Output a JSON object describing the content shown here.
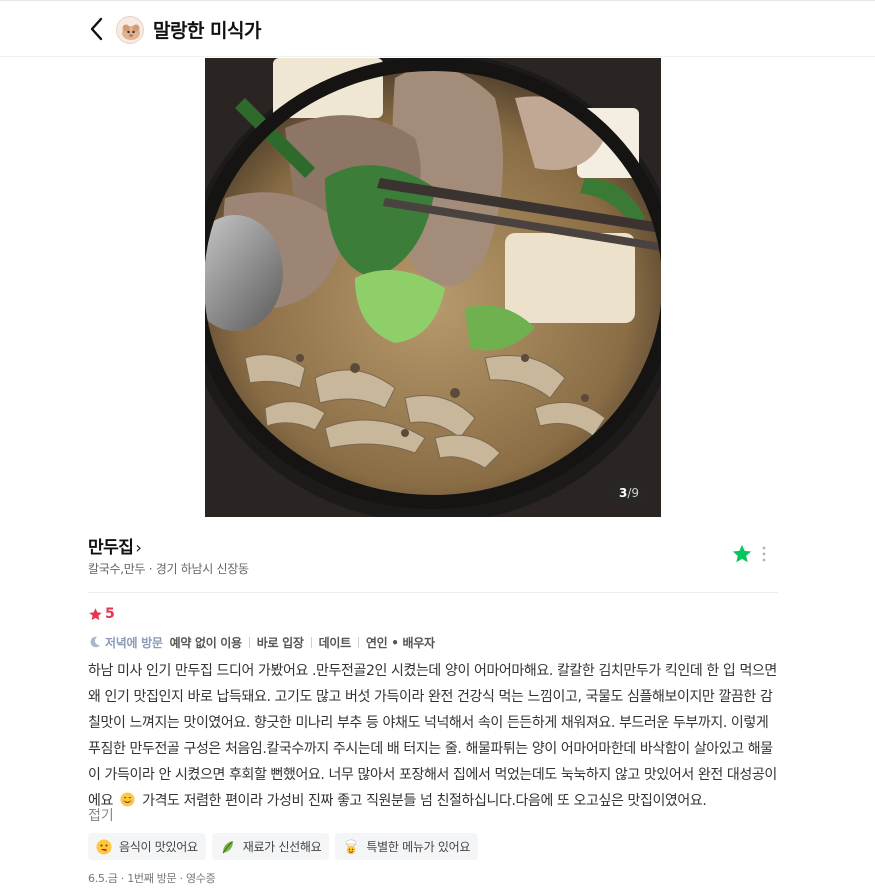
{
  "header": {
    "title": "말랑한 미식가"
  },
  "photo": {
    "current": "3",
    "separator": "/",
    "total": "9"
  },
  "place": {
    "name": "만두집",
    "category": "칼국수,만두",
    "dot": " · ",
    "location": "경기 하남시 신장동"
  },
  "rating": {
    "score": "5",
    "color": "#e8344e"
  },
  "visit_tags": {
    "time": "저녁에 방문",
    "items": [
      "예약 없이 이용",
      "바로 입장",
      "데이트",
      "연인 • 배우자"
    ]
  },
  "review": {
    "text_before_emoji": "하남 미사 인기 만두집 드디어 가봤어요 .만두전골2인 시켰는데 양이 어마어마해요. 칼칼한 김치만두가 킥인데 한 입 먹으면 왜 인기 맛집인지 바로 납득돼요. 고기도 많고 버섯 가득이라 완전 건강식 먹는 느낌이고, 국물도 심플해보이지만 깔끔한 감칠맛이 느껴지는 맛이였어요. 향긋한 미나리 부추 등 야채도 넉넉해서 속이 든든하게 채워져요. 부드러운 두부까지. 이렇게 푸짐한 만두전골 구성은 처음임.칼국수까지 주시는데 배 터지는 줄. 해물파튀는 양이 어마어마한데 바삭함이 살아있고 해물이 가득이라 안 시켰으면 후회할 뻔했어요. 너무 많아서 포장해서 집에서 먹었는데도 눅눅하지 않고 맛있어서 완전 대성공이에요",
    "emoji": "smiling-face-icon",
    "text_after_emoji": "가격도 저렴한 편이라 가성비 진짜 좋고 직원분들 넘 친절하십니다.다음에 또 오고싶은 맛집이였어요.",
    "fold_label": "접기"
  },
  "keywords": [
    {
      "icon": "yum-face-icon",
      "label": "음식이 맛있어요"
    },
    {
      "icon": "leaf-icon",
      "label": "재료가 신선해요"
    },
    {
      "icon": "chef-icon",
      "label": "특별한 메뉴가 있어요"
    }
  ],
  "footer": {
    "meta": "6.5.금 · 1번째 방문 · 영수증"
  },
  "colors": {
    "favorite_star": "#03c75a",
    "visit_time": "#8a9ab8",
    "keyword_bg": "#f4f5f7"
  }
}
